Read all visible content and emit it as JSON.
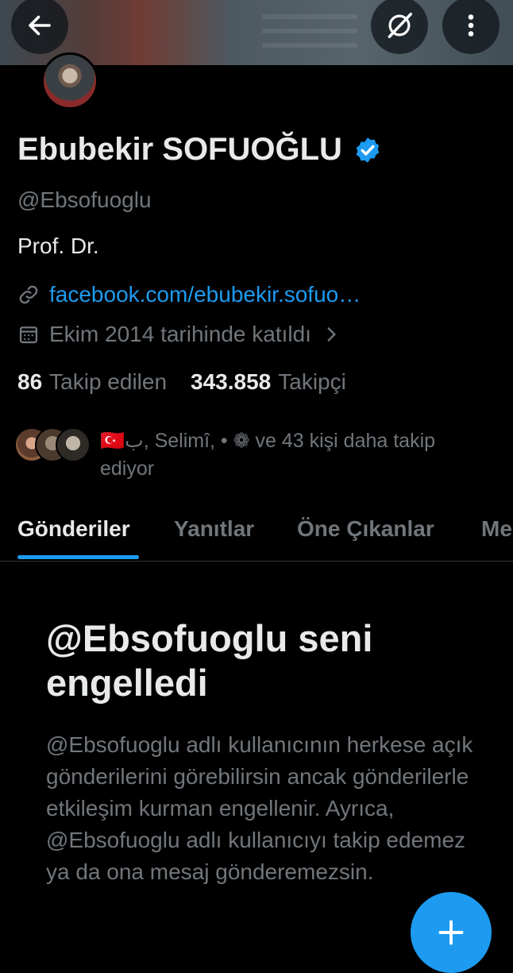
{
  "profile": {
    "name": "Ebubekir SOFUOĞLU",
    "handle": "@Ebsofuoglu",
    "bio": "Prof. Dr.",
    "link": "facebook.com/ebubekir.sofuo…",
    "joined": "Ekim 2014 tarihinde katıldı"
  },
  "stats": {
    "following_count": "86",
    "following_label": "Takip edilen",
    "followers_count": "343.858",
    "followers_label": "Takipçi"
  },
  "followed_by": {
    "text": "🇹🇷ب, Selimî, • ❁ ve 43 kişi daha takip ediyor"
  },
  "tabs": [
    "Gönderiler",
    "Yanıtlar",
    "Öne Çıkanlar",
    "Me"
  ],
  "blocked": {
    "title": "@Ebsofuoglu seni engelledi",
    "description": "@Ebsofuoglu adlı kullanıcının herkese açık gönderilerini görebilirsin ancak gönderilerle etkileşim kurman engellenir. Ayrıca, @Ebsofuoglu adlı kullanıcıyı takip edemez ya da ona mesaj gönderemezsin."
  },
  "colors": {
    "accent": "#1d9bf0",
    "background": "#000000",
    "text_primary": "#e7e9ea",
    "text_secondary": "#71767b"
  },
  "icons": {
    "back": "arrow-left-icon",
    "grok": "grok-icon",
    "more": "more-vertical-icon",
    "verified": "verified-badge-icon",
    "link": "link-icon",
    "calendar": "calendar-icon",
    "chevron": "chevron-right-icon",
    "fab": "plus-icon"
  }
}
